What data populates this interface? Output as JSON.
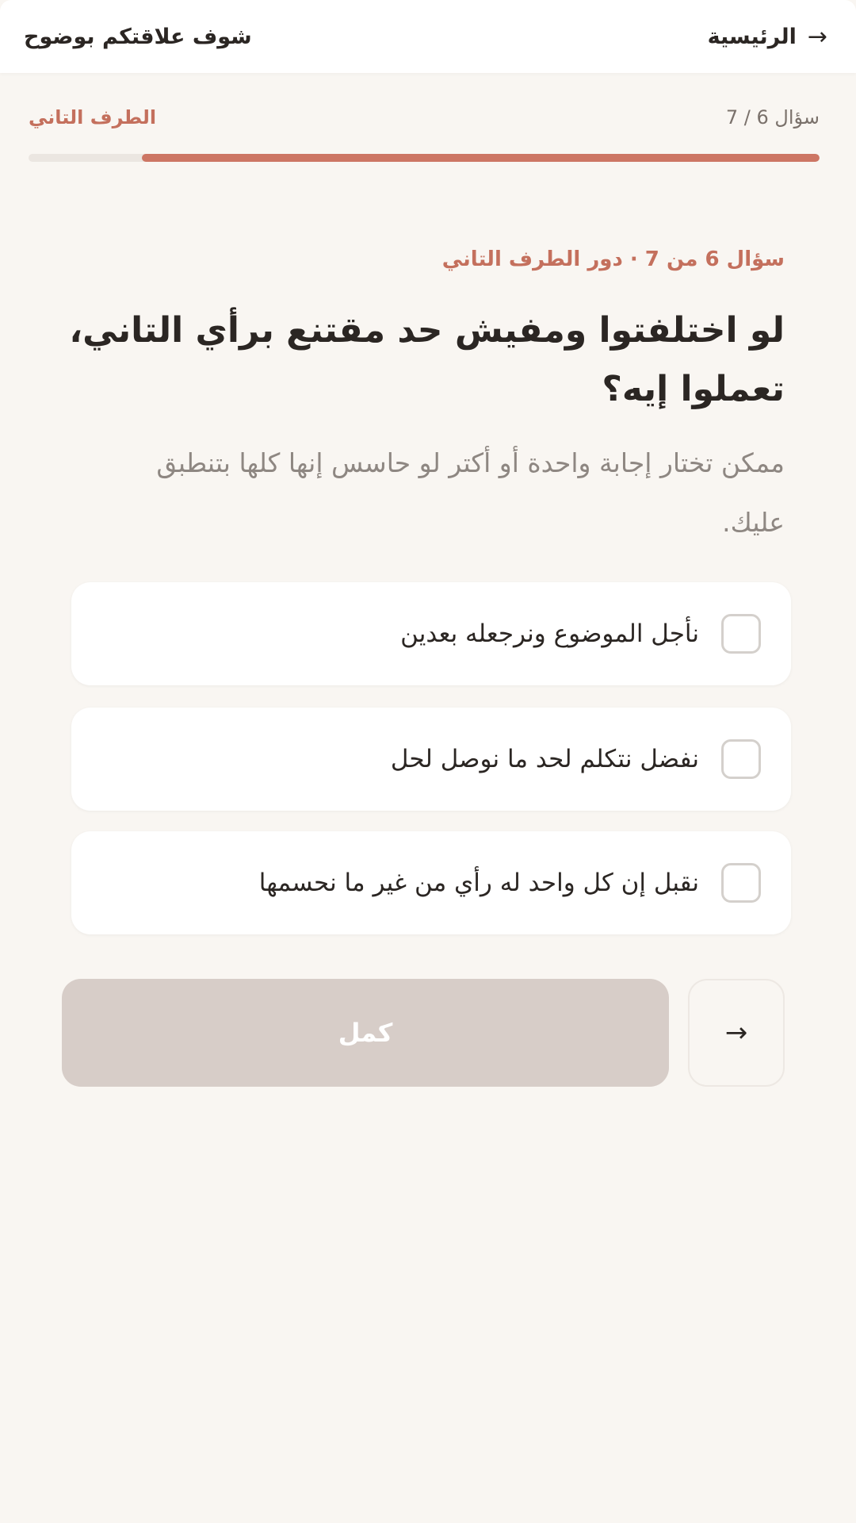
{
  "header": {
    "home_label": "الرئيسية",
    "home_arrow": "→",
    "brand": "شوف علاقتكم بوضوح"
  },
  "progress": {
    "step_text": "سؤال 6 / 7",
    "role_text": "الطرف التاني",
    "fraction": 0.857,
    "fill_color": "#cd7664",
    "track_color": "#ebe6e1"
  },
  "question": {
    "eyebrow": "سؤال 6 من 7 · دور الطرف التاني",
    "title": "لو اختلفتوا ومفيش حد مقتنع برأي التاني، تعملوا إيه؟",
    "hint": "ممكن تختار إجابة واحدة أو أكتر لو حاسس إنها كلها بتنطبق عليك."
  },
  "options": [
    {
      "label": "نأجل الموضوع ونرجعله بعدين",
      "checked": false
    },
    {
      "label": "نفضل نتكلم لحد ما نوصل لحل",
      "checked": false
    },
    {
      "label": "نقبل إن كل واحد له رأي من غير ما نحسمها",
      "checked": false
    }
  ],
  "actions": {
    "next_label": "كمل",
    "back_arrow": "→"
  },
  "colors": {
    "accent": "#c4705d",
    "background": "#f9f6f2",
    "disabled_button": "#d7cdc8"
  }
}
